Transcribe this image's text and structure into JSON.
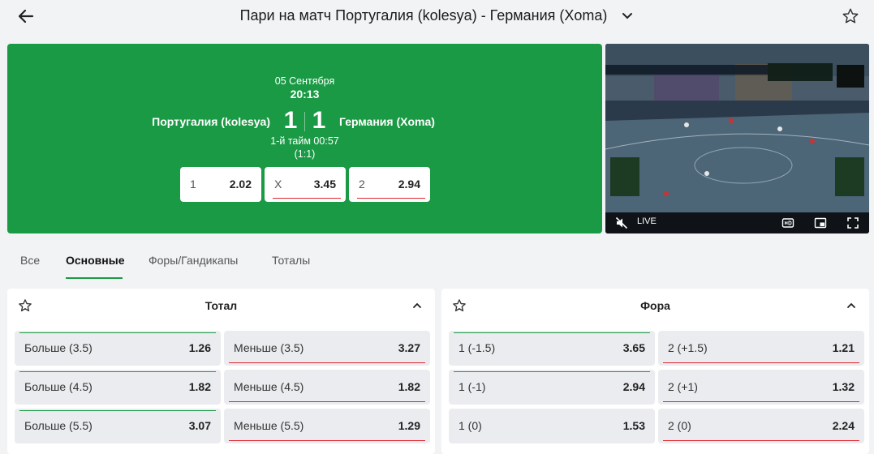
{
  "header": {
    "title": "Пари на матч Португалия (kolesya) - Германия (Xoma)"
  },
  "match": {
    "date": "05 Сентября",
    "time": "20:13",
    "team1": "Португалия (kolesya)",
    "team2": "Германия (Xoma)",
    "score1": "1",
    "score2": "1",
    "period": "1-й тайм 00:57",
    "half_score": "(1:1)",
    "odds": [
      {
        "label": "1",
        "value": "2.02"
      },
      {
        "label": "X",
        "value": "3.45"
      },
      {
        "label": "2",
        "value": "2.94"
      }
    ]
  },
  "video": {
    "live_label": "LIVE"
  },
  "tabs": [
    "Все",
    "Основные",
    "Форы/Гандикапы",
    "Тоталы"
  ],
  "panels": {
    "total": {
      "title": "Тотал",
      "rows": [
        {
          "left_label": "Больше (3.5)",
          "left_value": "1.26",
          "right_label": "Меньше (3.5)",
          "right_value": "3.27"
        },
        {
          "left_label": "Больше (4.5)",
          "left_value": "1.82",
          "right_label": "Меньше (4.5)",
          "right_value": "1.82"
        },
        {
          "left_label": "Больше (5.5)",
          "left_value": "3.07",
          "right_label": "Меньше (5.5)",
          "right_value": "1.29"
        }
      ]
    },
    "fora": {
      "title": "Фора",
      "rows": [
        {
          "left_label": "1 (-1.5)",
          "left_value": "3.65",
          "right_label": "2 (+1.5)",
          "right_value": "1.21"
        },
        {
          "left_label": "1 (-1)",
          "left_value": "2.94",
          "right_label": "2 (+1)",
          "right_value": "1.32"
        },
        {
          "left_label": "1 (0)",
          "left_value": "1.53",
          "right_label": "2 (0)",
          "right_value": "2.24"
        }
      ]
    }
  },
  "colors": {
    "brand_green": "#1b9a45",
    "rise_green": "#1b9a45",
    "drop_red": "#e0242c",
    "page_bg": "#f2f3f5"
  }
}
